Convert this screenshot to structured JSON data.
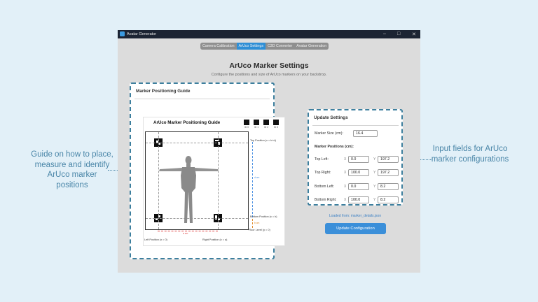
{
  "callouts": {
    "left": "Guide on how to place, measure and identify ArUco marker positions",
    "right": "Input fields for ArUco marker configurations"
  },
  "window": {
    "title": "Avatar Generator",
    "controls": {
      "minimize": "–",
      "maximize": "□",
      "close": "✕"
    }
  },
  "tabs": [
    {
      "label": "Camera Calibration",
      "active": false
    },
    {
      "label": "ArUco Settings",
      "active": true
    },
    {
      "label": "C3D Converter",
      "active": false
    },
    {
      "label": "Avatar Generation",
      "active": false
    }
  ],
  "page": {
    "title": "ArUco Marker Settings",
    "subtitle": "Configure the positions and size of ArUco markers on your backdrop."
  },
  "guide_panel": {
    "heading": "Marker Positioning Guide",
    "guide_title": "ArUco Marker Positioning Guide",
    "legend": [
      "ID 0",
      "ID 1",
      "ID 2",
      "ID 3"
    ],
    "labels": {
      "top_position": "Top Position (x = b+d)",
      "bottom_position": "Bottom Position (x = b)",
      "floor_level": "Floor Level (y = 0)",
      "left_position": "Left Position (x = 0)",
      "right_position": "Right Position (x = a)",
      "dim_a": "a cm",
      "dim_b": "b cm",
      "dim_d": "d cm"
    }
  },
  "settings": {
    "heading": "Update Settings",
    "marker_size_label": "Marker Size (cm):",
    "marker_size": "16.4",
    "positions_label": "Marker Positions (cm):",
    "x_label": "X",
    "y_label": "Y",
    "positions": [
      {
        "label": "Top Left:",
        "x": "0.0",
        "y": "197.2"
      },
      {
        "label": "Top Right:",
        "x": "100.0",
        "y": "197.2"
      },
      {
        "label": "Bottom Left:",
        "x": "0.0",
        "y": "8.2"
      },
      {
        "label": "Bottom Right:",
        "x": "100.0",
        "y": "8.2"
      }
    ],
    "loaded_from": "Loaded from: marker_details.json",
    "update_button": "Update Configuration"
  },
  "colors": {
    "accent": "#3b8fd9",
    "callout": "#4a86a8",
    "titlebar": "#1c2433",
    "background": "#e2f0f8"
  }
}
